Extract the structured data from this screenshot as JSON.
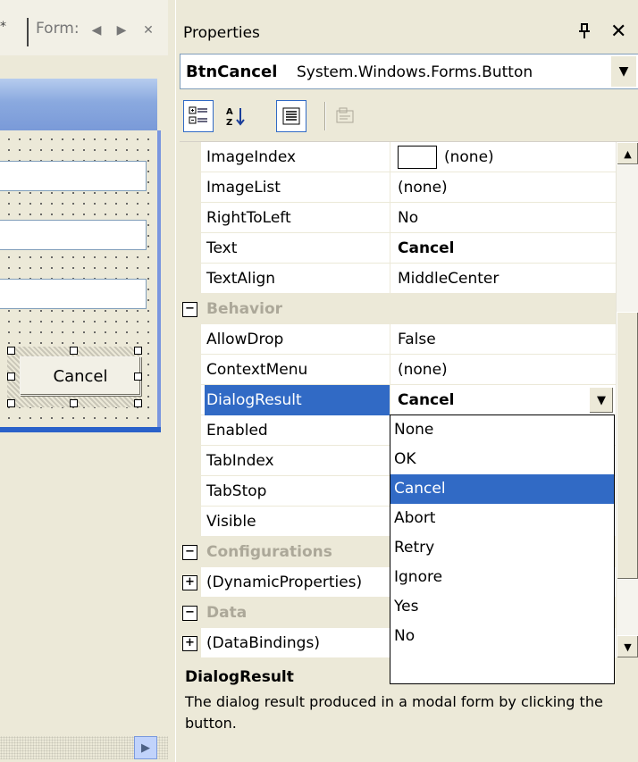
{
  "left_panel": {
    "tab_tail": "*",
    "tab_label": "Form:",
    "nav_prev": "◀",
    "nav_next": "▶",
    "nav_close": "✕",
    "cancel_button_text": "Cancel",
    "scroll_right_arrow": "▶"
  },
  "properties": {
    "title": "Properties",
    "pin_glyph": "ᵖ",
    "close_glyph": "✕",
    "selector": {
      "object_name": "BtnCancel",
      "object_type": "System.Windows.Forms.Button",
      "dropdown_arrow": "▼"
    },
    "toolbar": {
      "categorized_icon": "categorized-icon",
      "alphabetical_icon": "alphabetical-icon",
      "properties_icon": "properties-icon",
      "property_pages_icon": "property-pages-icon"
    },
    "rows": [
      {
        "type": "prop",
        "name": "ImageIndex",
        "value": "(none)",
        "bold": false,
        "swatch": true
      },
      {
        "type": "prop",
        "name": "ImageList",
        "value": "(none)"
      },
      {
        "type": "prop",
        "name": "RightToLeft",
        "value": "No"
      },
      {
        "type": "prop",
        "name": "Text",
        "value": "Cancel",
        "bold": true
      },
      {
        "type": "prop",
        "name": "TextAlign",
        "value": "MiddleCenter"
      },
      {
        "type": "cat",
        "name": "Behavior",
        "expander": "−"
      },
      {
        "type": "prop",
        "name": "AllowDrop",
        "value": "False"
      },
      {
        "type": "prop",
        "name": "ContextMenu",
        "value": "(none)"
      },
      {
        "type": "prop",
        "name": "DialogResult",
        "value": "Cancel",
        "selected": true
      },
      {
        "type": "prop",
        "name": "Enabled",
        "value": ""
      },
      {
        "type": "prop",
        "name": "TabIndex",
        "value": ""
      },
      {
        "type": "prop",
        "name": "TabStop",
        "value": ""
      },
      {
        "type": "prop",
        "name": "Visible",
        "value": ""
      },
      {
        "type": "cat",
        "name": "Configurations",
        "expander": "−"
      },
      {
        "type": "expand",
        "name": "(DynamicProperties)",
        "value": "",
        "expander": "+"
      },
      {
        "type": "cat",
        "name": "Data",
        "expander": "−"
      },
      {
        "type": "expand",
        "name": "(DataBindings)",
        "value": "",
        "expander": "+"
      }
    ],
    "dropdown_arrow": "▼",
    "dropdown_options": [
      "None",
      "OK",
      "Cancel",
      "Abort",
      "Retry",
      "Ignore",
      "Yes",
      "No"
    ],
    "dropdown_selected": "Cancel",
    "scroll_up": "▲",
    "scroll_down": "▼",
    "description": {
      "title": "DialogResult",
      "text": "The dialog result produced in a modal form by clicking the button."
    }
  },
  "colors": {
    "selection": "#316ac5",
    "chrome": "#ece9d8",
    "form_titlebar": "#8aa9df"
  }
}
